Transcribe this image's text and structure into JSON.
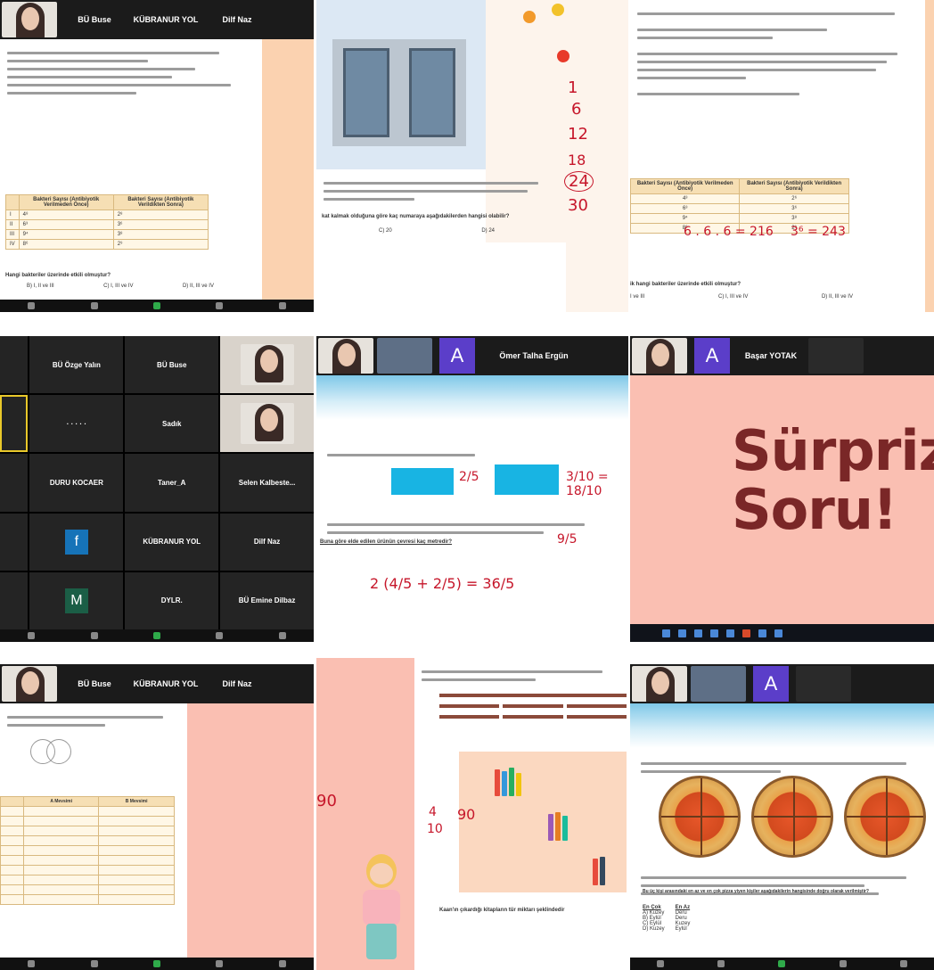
{
  "tile1": {
    "strip_names": [
      "BÜ Buse",
      "KÜBRANUR YOL",
      "Dilf Naz"
    ],
    "table_headers": [
      "Bakteri Sayısı\n(Antibiyotik Verilmeden Önce)",
      "Bakteri Sayısı\n(Antibiyotik Verildikten Sonra)"
    ],
    "rows": [
      [
        "I",
        "4⁸",
        "2⁸"
      ],
      [
        "II",
        "6³",
        "3⁶"
      ],
      [
        "III",
        "9⁴",
        "3⁸"
      ],
      [
        "IV",
        "8⁶",
        "2⁹"
      ]
    ],
    "question": "Hangi bakteriler üzerinde etkili olmuştur?",
    "choices": [
      "B) I, II ve III",
      "C) I, III ve IV",
      "D) II, III ve IV"
    ]
  },
  "tile2": {
    "question": "kat kalmak olduğuna göre kaç numaraya aşağıdakilerden hangisi olabilir?",
    "choices": [
      "C) 20",
      "D) 24"
    ],
    "handwriting": [
      "1",
      "6",
      "12",
      "18",
      "24",
      "30"
    ]
  },
  "tile3": {
    "table_headers": [
      "Bakteri Sayısı\n(Antibiyotik Verilmeden Önce)",
      "Bakteri Sayısı\n(Antibiyotik Verildikten Sonra)"
    ],
    "rows": [
      [
        "4³",
        "2⁶"
      ],
      [
        "6³",
        "3⁶"
      ],
      [
        "9⁴",
        "3⁸"
      ],
      [
        "8⁶",
        "2⁹"
      ]
    ],
    "annotations": [
      "6 . 6 . 6 = 216",
      "3⁶ = 243"
    ],
    "question": "ik hangi bakteriler üzerinde etkili olmuştur?",
    "choices": [
      "I ve III",
      "C) I, III ve IV",
      "D) II, III ve IV"
    ]
  },
  "tile4": {
    "cells": [
      "BÜ Özge Yalın",
      "BÜ Buse",
      "",
      "",
      "Sadık",
      "",
      "DURU KOCAER",
      "Taner_A",
      "Selen Kalbeste...",
      "",
      "KÜBRANUR YOL",
      "Dilf Naz",
      "",
      "DYLR.",
      "BÜ Emine Dilbaz"
    ],
    "letters": [
      "f",
      "M"
    ],
    "letter_colors": [
      "#1673b8",
      "#1b5e46"
    ]
  },
  "tile5": {
    "strip_names": [
      "Ömer Talha Ergün"
    ],
    "avatar_letter": "A",
    "fractions": [
      "2/5",
      "3/10 = 18/10"
    ],
    "question": "Buna göre elde edilen ürünün çevresi kaç metredir?",
    "handwriting": "2 (4/5 + 2/5) = 36/5",
    "side": "9/5"
  },
  "tile6": {
    "avatar_letter": "A",
    "strip_names": [
      "Başar YOTAK"
    ],
    "title_line1": "Sürpriz",
    "title_line2": "Soru!"
  },
  "tile7": {
    "strip_names": [
      "BÜ Buse",
      "KÜBRANUR YOL",
      "Dilf Naz"
    ],
    "columns": [
      "",
      "A Mevsimi",
      "B Mevsimi"
    ]
  },
  "tile8": {
    "handwriting": [
      "90",
      "4",
      "10",
      "90"
    ],
    "question": "Kaan'ın çıkardığı kitapların tür miktarı şeklindedir"
  },
  "tile9": {
    "avatar_letter": "A",
    "question": "Bu üç kişi arasındaki en az ve en çok pizza yiyen kişiler aşağıdakilerin hangisinde doğru olarak verilmiştir?",
    "columns": [
      "En Çok",
      "En Az"
    ],
    "rows": [
      [
        "A) Kuzey",
        "Deru"
      ],
      [
        "B) Eylül",
        "Deru"
      ],
      [
        "C) Eylül",
        "Kuzey"
      ],
      [
        "D) Kuzey",
        "Eylül"
      ]
    ]
  }
}
